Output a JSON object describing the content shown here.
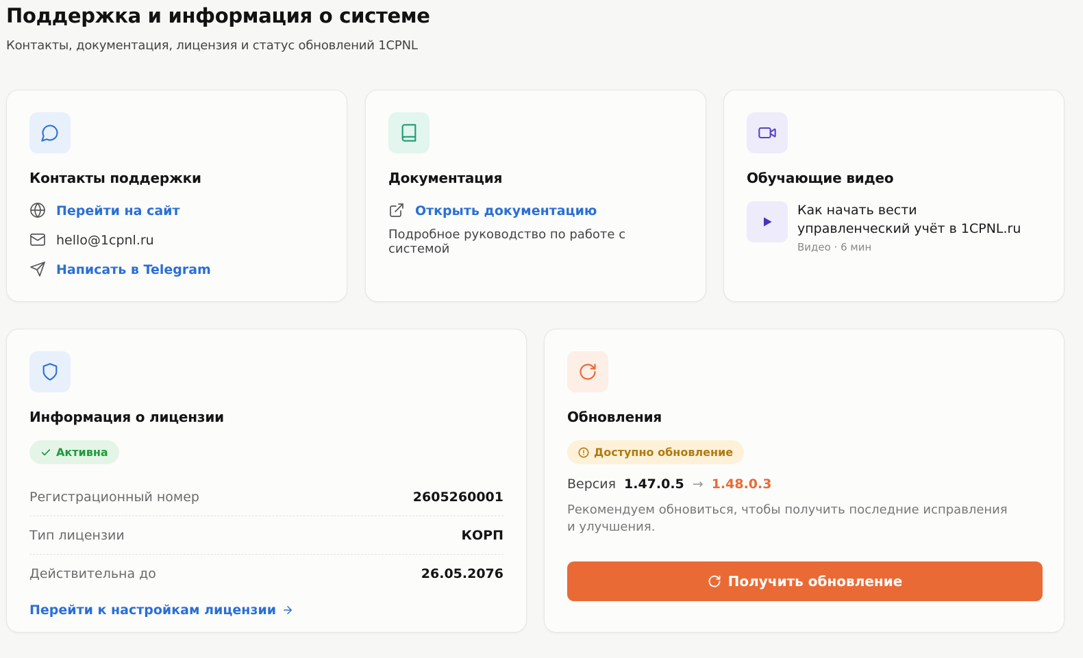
{
  "header": {
    "title": "Поддержка и информация о системе",
    "subtitle": "Контакты, документация, лицензия и статус обновлений 1CPNL"
  },
  "contacts": {
    "icon": "chat-bubble-icon",
    "title": "Контакты поддержки",
    "website_label": "Перейти на сайт",
    "email": "hello@1cpnl.ru",
    "telegram_label": "Написать в Telegram"
  },
  "docs": {
    "icon": "book-icon",
    "title": "Документация",
    "open_label": "Открыть документацию",
    "description": "Подробное руководство по работе с системой"
  },
  "videos": {
    "icon": "video-camera-icon",
    "title": "Обучающие видео",
    "items": [
      {
        "title": "Как начать вести управленческий учёт в 1CPNL.ru",
        "meta": "Видео · 6 мин"
      }
    ]
  },
  "license": {
    "icon": "shield-icon",
    "title": "Информация о лицензии",
    "status": "Активна",
    "rows": [
      {
        "label": "Регистрационный номер",
        "value": "2605260001"
      },
      {
        "label": "Тип лицензии",
        "value": "КОРП"
      },
      {
        "label": "Действительна до",
        "value": "26.05.2076"
      }
    ],
    "settings_link": "Перейти к настройкам лицензии"
  },
  "updates": {
    "icon": "refresh-icon",
    "title": "Обновления",
    "status": "Доступно обновление",
    "version_label": "Версия",
    "current_version": "1.47.0.5",
    "arrow": "→",
    "new_version": "1.48.0.3",
    "description": "Рекомендуем обновиться, чтобы получить последние исправления и улучшения.",
    "button_label": "Получить обновление"
  },
  "colors": {
    "accent_blue": "#2a6fd6",
    "accent_orange": "#ea6a35",
    "status_green": "#1f9a3b",
    "status_yellow": "#b07a10"
  }
}
